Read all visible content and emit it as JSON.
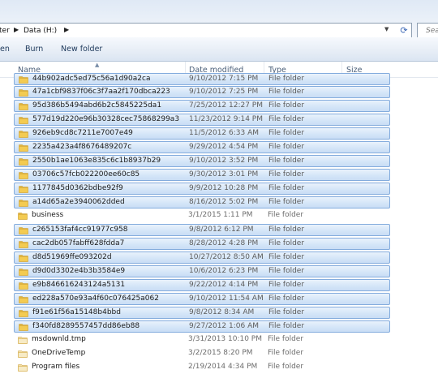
{
  "address": {
    "crumbs": [
      "ter",
      "Data (H:)"
    ],
    "search_placeholder": "Sea"
  },
  "toolbar": {
    "open_label": "en",
    "burn_label": "Burn",
    "new_folder_label": "New folder"
  },
  "columns": {
    "name": "Name",
    "date": "Date modified",
    "type": "Type",
    "size": "Size"
  },
  "rows": [
    {
      "name": "44b902adc5ed75c56a1d90a2ca",
      "date": "9/10/2012 7:15 PM",
      "type": "File folder",
      "kind": "folder",
      "selected": true
    },
    {
      "name": "47a1cbf9837f06c3f7aa2f170dbca223",
      "date": "9/10/2012 7:25 PM",
      "type": "File folder",
      "kind": "folder",
      "selected": true
    },
    {
      "name": "95d386b5494abd6b2c5845225da1",
      "date": "7/25/2012 12:27 PM",
      "type": "File folder",
      "kind": "folder",
      "selected": true
    },
    {
      "name": "577d19d220e96b30328cec75868299a3",
      "date": "11/23/2012 9:14 PM",
      "type": "File folder",
      "kind": "folder",
      "selected": true
    },
    {
      "name": "926eb9cd8c7211e7007e49",
      "date": "11/5/2012 6:33 AM",
      "type": "File folder",
      "kind": "folder",
      "selected": true
    },
    {
      "name": "2235a423a4f8676489207c",
      "date": "9/29/2012 4:54 PM",
      "type": "File folder",
      "kind": "folder",
      "selected": true
    },
    {
      "name": "2550b1ae1063e835c6c1b8937b29",
      "date": "9/10/2012 3:52 PM",
      "type": "File folder",
      "kind": "folder",
      "selected": true
    },
    {
      "name": "03706c57fcb022200ee60c85",
      "date": "9/30/2012 3:01 PM",
      "type": "File folder",
      "kind": "folder",
      "selected": true
    },
    {
      "name": "1177845d0362bdbe92f9",
      "date": "9/9/2012 10:28 PM",
      "type": "File folder",
      "kind": "folder",
      "selected": true
    },
    {
      "name": "a14d65a2e3940062dded",
      "date": "8/16/2012 5:02 PM",
      "type": "File folder",
      "kind": "folder",
      "selected": true
    },
    {
      "name": "business",
      "date": "3/1/2015 1:11 PM",
      "type": "File folder",
      "kind": "folder",
      "selected": false
    },
    {
      "name": "c265153faf4cc91977c958",
      "date": "9/8/2012 6:12 PM",
      "type": "File folder",
      "kind": "folder",
      "selected": true
    },
    {
      "name": "cac2db057fabff628fdda7",
      "date": "8/28/2012 4:28 PM",
      "type": "File folder",
      "kind": "folder",
      "selected": true
    },
    {
      "name": "d8d51969ffe093202d",
      "date": "10/27/2012 8:50 AM",
      "type": "File folder",
      "kind": "folder",
      "selected": true
    },
    {
      "name": "d9d0d3302e4b3b3584e9",
      "date": "10/6/2012 6:23 PM",
      "type": "File folder",
      "kind": "folder",
      "selected": true
    },
    {
      "name": "e9b846616243124a5131",
      "date": "9/22/2012 4:14 PM",
      "type": "File folder",
      "kind": "folder",
      "selected": true
    },
    {
      "name": "ed228a570e93a4f60c076425a062",
      "date": "9/10/2012 11:54 AM",
      "type": "File folder",
      "kind": "folder",
      "selected": true
    },
    {
      "name": "f91e61f56a15148b4bbd",
      "date": "9/8/2012 8:34 AM",
      "type": "File folder",
      "kind": "folder",
      "selected": true
    },
    {
      "name": "f340fd8289557457dd86eb88",
      "date": "9/27/2012 1:06 AM",
      "type": "File folder",
      "kind": "folder",
      "selected": true
    },
    {
      "name": "msdownld.tmp",
      "date": "3/31/2013 10:10 PM",
      "type": "File folder",
      "kind": "folder-hidden",
      "selected": false
    },
    {
      "name": "OneDriveTemp",
      "date": "3/2/2015 8:20 PM",
      "type": "File folder",
      "kind": "folder-hidden",
      "selected": false
    },
    {
      "name": "Program files",
      "date": "2/19/2014 4:34 PM",
      "type": "File folder",
      "kind": "folder-hidden",
      "selected": false
    }
  ],
  "colors": {
    "selection_fill": "#d5e6f8",
    "selection_border": "#84acdd",
    "folder_yellow": "#f3cb52"
  }
}
